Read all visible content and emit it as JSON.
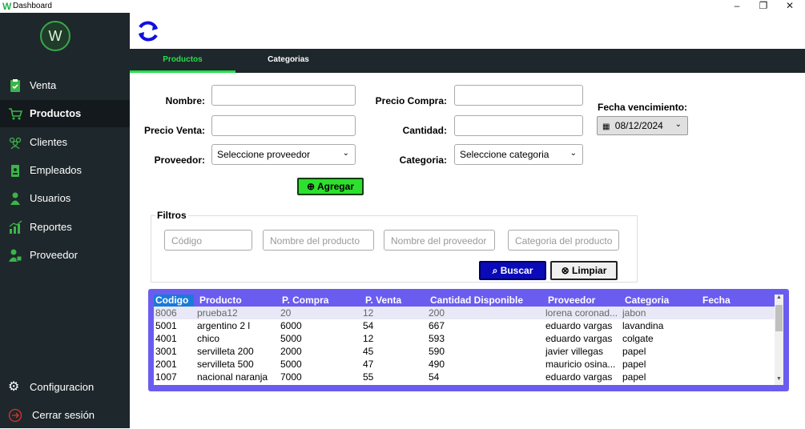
{
  "window": {
    "title": "Dashboard",
    "logo": "W",
    "controls": {
      "minimize": "–",
      "restore": "❐",
      "close": "✕"
    }
  },
  "sidebar": {
    "brand": "W",
    "items": [
      {
        "label": "Venta",
        "icon": "clipboard-icon"
      },
      {
        "label": "Productos",
        "icon": "cart-icon"
      },
      {
        "label": "Clientes",
        "icon": "people-icon"
      },
      {
        "label": "Empleados",
        "icon": "badge-icon"
      },
      {
        "label": "Usuarios",
        "icon": "user-icon"
      },
      {
        "label": "Reportes",
        "icon": "chart-icon"
      },
      {
        "label": "Proveedor",
        "icon": "supplier-icon"
      }
    ],
    "bottom": [
      {
        "label": "Configuracion",
        "icon": "gear-icon"
      },
      {
        "label": "Cerrar sesión",
        "icon": "logout-icon"
      }
    ]
  },
  "tabs": [
    {
      "label": "Productos"
    },
    {
      "label": "Categorias"
    }
  ],
  "form": {
    "nombre_label": "Nombre:",
    "precio_venta_label": "Precio Venta:",
    "proveedor_label": "Proveedor:",
    "proveedor_value": "Seleccione proveedor",
    "precio_compra_label": "Precio Compra:",
    "cantidad_label": "Cantidad:",
    "categoria_label": "Categoria:",
    "categoria_value": "Seleccione categoria",
    "fecha_label": "Fecha vencimiento:",
    "fecha_value": "08/12/2024",
    "add_label": "Agregar"
  },
  "filters": {
    "title": "Filtros",
    "codigo_placeholder": "Código",
    "producto_placeholder": "Nombre del producto",
    "proveedor_placeholder": "Nombre del proveedor",
    "categoria_placeholder": "Categoria del producto",
    "search_label": "Buscar",
    "clear_label": "Limpiar"
  },
  "table": {
    "headers": [
      "Codigo",
      "Producto",
      "P. Compra",
      "P. Venta",
      "Cantidad Disponible",
      "Proveedor",
      "Categoria",
      "Fecha"
    ],
    "rows": [
      [
        "8006",
        "prueba12",
        "20",
        "12",
        "200",
        "lorena coronad...",
        "jabon",
        ""
      ],
      [
        "5001",
        "argentino 2 l",
        "6000",
        "54",
        "667",
        "eduardo vargas",
        "lavandina",
        ""
      ],
      [
        "4001",
        "chico",
        "5000",
        "12",
        "593",
        "eduardo vargas",
        "colgate",
        ""
      ],
      [
        "3001",
        "servilleta 200",
        "2000",
        "45",
        "590",
        "javier villegas",
        "papel",
        ""
      ],
      [
        "2001",
        "servilleta 500",
        "5000",
        "47",
        "490",
        "mauricio osina...",
        "papel",
        ""
      ],
      [
        "1007",
        "nacional naranja",
        "7000",
        "55",
        "54",
        "eduardo vargas",
        "papel",
        ""
      ]
    ]
  },
  "colors": {
    "sidebar": "#1e272b",
    "accent_green": "#22e04a",
    "table_header": "#6b5cf0",
    "search_button": "#0a0ab8"
  }
}
